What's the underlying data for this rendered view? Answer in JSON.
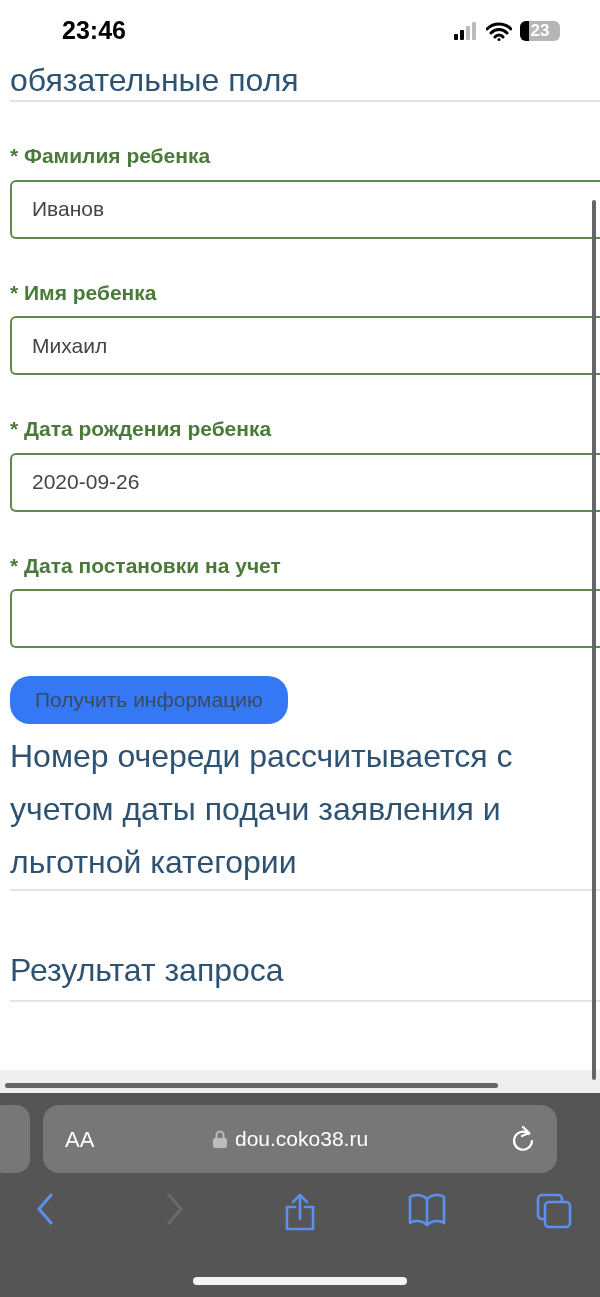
{
  "status_bar": {
    "time": "23:46",
    "battery": {
      "text": "23",
      "level": 0.23
    }
  },
  "section_title": "обязательные поля",
  "fields": [
    {
      "label": "* Фамилия ребенка",
      "value": "Иванов"
    },
    {
      "label": "* Имя ребенка",
      "value": "Михаил"
    },
    {
      "label": "* Дата рождения ребенка",
      "value": "2020-09-26"
    },
    {
      "label": "* Дата постановки на учет"
    }
  ],
  "submit_button": "Получить информацию",
  "note": "Номер очереди рассчитывается с учетом даты подачи заявления и льготной категории",
  "result_title": "Результат запроса",
  "browser": {
    "text_size_button": "AA",
    "url": "dou.coko38.ru",
    "back_enabled": true,
    "forward_enabled": false
  }
}
